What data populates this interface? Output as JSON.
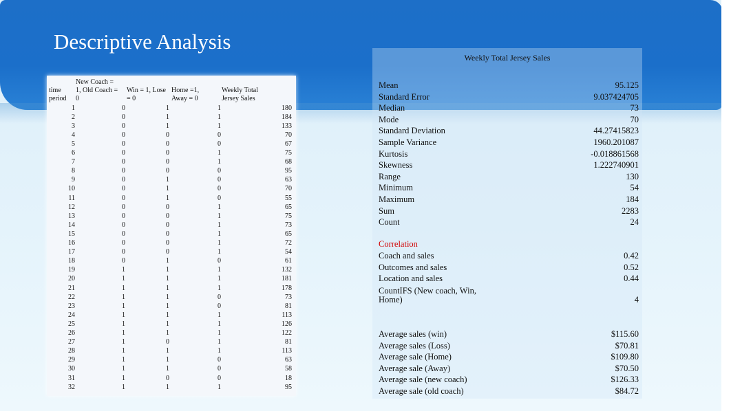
{
  "slide": {
    "title": "Descriptive Analysis"
  },
  "left_table": {
    "headers": [
      "time period",
      "New Coach = 1, Old Coach = 0",
      "Win = 1, Lose = 0",
      "Home =1, Away = 0",
      "Weekly Total Jersey Sales"
    ],
    "rows": [
      [
        "1",
        "0",
        "1",
        "1",
        "180"
      ],
      [
        "2",
        "0",
        "1",
        "1",
        "184"
      ],
      [
        "3",
        "0",
        "1",
        "1",
        "133"
      ],
      [
        "4",
        "0",
        "0",
        "0",
        "70"
      ],
      [
        "5",
        "0",
        "0",
        "0",
        "67"
      ],
      [
        "6",
        "0",
        "0",
        "1",
        "75"
      ],
      [
        "7",
        "0",
        "0",
        "1",
        "68"
      ],
      [
        "8",
        "0",
        "0",
        "0",
        "95"
      ],
      [
        "9",
        "0",
        "1",
        "0",
        "63"
      ],
      [
        "10",
        "0",
        "1",
        "0",
        "70"
      ],
      [
        "11",
        "0",
        "1",
        "0",
        "55"
      ],
      [
        "12",
        "0",
        "0",
        "1",
        "65"
      ],
      [
        "13",
        "0",
        "0",
        "1",
        "75"
      ],
      [
        "14",
        "0",
        "0",
        "1",
        "73"
      ],
      [
        "15",
        "0",
        "0",
        "1",
        "65"
      ],
      [
        "16",
        "0",
        "0",
        "1",
        "72"
      ],
      [
        "17",
        "0",
        "0",
        "1",
        "54"
      ],
      [
        "18",
        "0",
        "1",
        "0",
        "61"
      ],
      [
        "19",
        "1",
        "1",
        "1",
        "132"
      ],
      [
        "20",
        "1",
        "1",
        "1",
        "181"
      ],
      [
        "21",
        "1",
        "1",
        "1",
        "178"
      ],
      [
        "22",
        "1",
        "1",
        "0",
        "73"
      ],
      [
        "23",
        "1",
        "1",
        "0",
        "81"
      ],
      [
        "24",
        "1",
        "1",
        "1",
        "113"
      ],
      [
        "25",
        "1",
        "1",
        "1",
        "126"
      ],
      [
        "26",
        "1",
        "1",
        "1",
        "122"
      ],
      [
        "27",
        "1",
        "0",
        "1",
        "81"
      ],
      [
        "28",
        "1",
        "1",
        "1",
        "113"
      ],
      [
        "29",
        "1",
        "1",
        "0",
        "63"
      ],
      [
        "30",
        "1",
        "1",
        "0",
        "58"
      ],
      [
        "31",
        "1",
        "0",
        "0",
        "18"
      ],
      [
        "32",
        "1",
        "1",
        "1",
        "95"
      ]
    ]
  },
  "stats": {
    "title": "Weekly Total Jersey Sales",
    "descriptive": [
      {
        "label": "Mean",
        "value": "95.125"
      },
      {
        "label": "Standard Error",
        "value": "9.037424705"
      },
      {
        "label": "Median",
        "value": "73"
      },
      {
        "label": "Mode",
        "value": "70"
      },
      {
        "label": "Standard Deviation",
        "value": "44.27415823"
      },
      {
        "label": "Sample Variance",
        "value": "1960.201087"
      },
      {
        "label": "Kurtosis",
        "value": "-0.018861568"
      },
      {
        "label": "Skewness",
        "value": "1.222740901"
      },
      {
        "label": "Range",
        "value": "130"
      },
      {
        "label": "Minimum",
        "value": "54"
      },
      {
        "label": "Maximum",
        "value": "184"
      },
      {
        "label": "Sum",
        "value": "2283"
      },
      {
        "label": "Count",
        "value": "24"
      }
    ],
    "correlation_heading": "Correlation",
    "correlation": [
      {
        "label": "Coach and sales",
        "value": "0.42"
      },
      {
        "label": "Outcomes and sales",
        "value": "0.52"
      },
      {
        "label": "Location and sales",
        "value": "0.44"
      }
    ],
    "countifs_label_line1": "CountIFS (New coach, Win,",
    "countifs_label_line2": "Home)",
    "countifs_value": "4",
    "averages": [
      {
        "label": "Average sales (win)",
        "value": "$115.60"
      },
      {
        "label": "Average sales (Loss)",
        "value": "$70.81"
      },
      {
        "label": "Average sale (Home)",
        "value": "$109.80"
      },
      {
        "label": "Average sale (Away)",
        "value": "$70.50"
      },
      {
        "label": "Average sale (new coach)",
        "value": "$126.33"
      },
      {
        "label": "Average sale (old coach)",
        "value": "$84.72"
      }
    ]
  }
}
